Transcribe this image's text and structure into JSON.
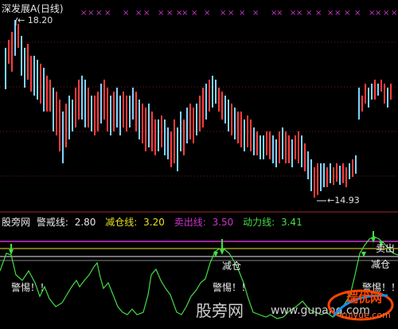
{
  "chart_title": "深发展A(日线)",
  "price_high_label": "18.20",
  "price_low_label": "14.93",
  "indicator": {
    "source": "股旁网",
    "items": [
      {
        "label": "警戒线:",
        "value": "2.80",
        "color": "#e8e8e8"
      },
      {
        "label": "减仓线:",
        "value": "3.20",
        "color": "#e8e020"
      },
      {
        "label": "卖出线:",
        "value": "3.50",
        "color": "#cc33cc"
      },
      {
        "label": "动力线:",
        "value": "3.41",
        "color": "#44dd44"
      }
    ]
  },
  "annotations": {
    "warning": "警惕！！",
    "reduce": "减仓",
    "sell": "卖出"
  },
  "watermark": {
    "site": "股旁网",
    "url_fragment": "www.gupang.com",
    "logo_text": "瑞优网",
    "logo_url": "ruiyue.com"
  },
  "colors": {
    "up_candle": "#ff3b3b",
    "down_candle": "#7fd4ff",
    "marker": "#cc33cc",
    "power_line": "#44dd44",
    "sell_line": "#cc33cc",
    "reduce_line": "#e8e020",
    "alert_line": "#e8e8e8",
    "grid": "#8b1a1a"
  }
}
